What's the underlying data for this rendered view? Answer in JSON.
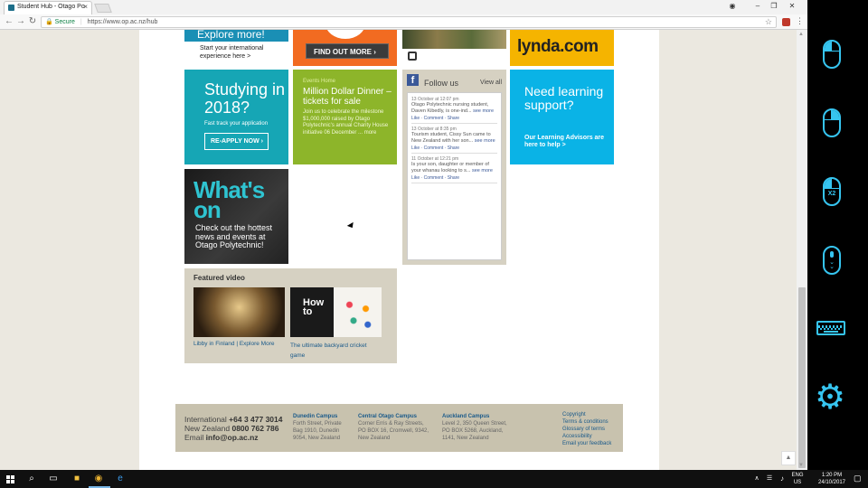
{
  "browser": {
    "tab_title": "Student Hub - Otago Po",
    "secure_label": "Secure",
    "url": "https://www.op.ac.nz/hub"
  },
  "tiles": {
    "explore": {
      "heading": "Explore more!",
      "text": "Start your international experience here >"
    },
    "findout": {
      "button": "FIND OUT MORE"
    },
    "lynda": {
      "logo": "lynda.com"
    },
    "studying": {
      "heading": "Studying in 2018?",
      "sub": "Fast track your application",
      "button": "RE-APPLY NOW"
    },
    "dinner": {
      "category": "Events Home",
      "heading": "Million Dollar Dinner – tickets for sale",
      "body": "Join us to celebrate the milestone $1,000,000 raised by Otago Polytechnic's annual Charity House initiative 06 December ... more"
    },
    "follow": {
      "title": "Follow us",
      "view_all": "View all",
      "posts": [
        {
          "date": "13 October at 12:07 pm",
          "text": "Otago Polytechnic nursing student, Daven Kibedly, is one-ind...",
          "see": "see more",
          "actions": "Like · Comment · Share"
        },
        {
          "date": "13 October at 8:35 pm",
          "text": "Tourism student, Cissy Sun came to New Zealand with her son...",
          "see": "see more",
          "actions": "Like · Comment · Share"
        },
        {
          "date": "11 October at 12:21 pm",
          "text": "Is your son, daughter or member of your whanau looking to s...",
          "see": "see more",
          "actions": "Like · Comment · Share"
        }
      ]
    },
    "need": {
      "heading": "Need learning support?",
      "sub": "Our Learning Advisors are here to help >"
    },
    "whats": {
      "big": "What's on",
      "sub": "Check out the hottest news and events at Otago Polytechnic!"
    },
    "video": {
      "heading": "Featured video",
      "v2_title": "How to",
      "caption1": "Libby in Finland | Explore More",
      "caption2": "The ultimate backyard cricket game"
    }
  },
  "footer": {
    "intl_label": "International",
    "intl_phone": "+64 3 477 3014",
    "nz_label": "New Zealand",
    "nz_phone": "0800 762 786",
    "email_label": "Email",
    "email": "info@op.ac.nz",
    "campuses": [
      {
        "name": "Dunedin Campus",
        "address": "Forth Street, Private Bag 1910, Dunedin 9054, New Zealand"
      },
      {
        "name": "Central Otago Campus",
        "address": "Corner Erris & Ray Streets, PO BOX 16, Cromwell, 9342, New Zealand"
      },
      {
        "name": "Auckland Campus",
        "address": "Level 2, 350 Queen Street, PO BOX 5268, Auckland, 1141, New Zealand"
      }
    ],
    "links": [
      "Copyright",
      "Terms & conditions",
      "Glossary of terms",
      "Accessibility",
      "Email your feedback"
    ]
  },
  "taskbar": {
    "lang": "ENG US",
    "time": "1:20 PM",
    "date": "24/10/2017"
  },
  "side_panel": {
    "double_click_label": "X2"
  }
}
